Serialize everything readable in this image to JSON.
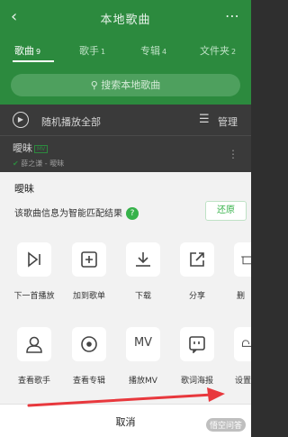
{
  "header": {
    "title": "本地歌曲",
    "back_icon": "back-arrow-icon",
    "more_icon": "more-dots-icon"
  },
  "tabs": [
    {
      "label": "歌曲",
      "count": "9",
      "active": true
    },
    {
      "label": "歌手",
      "count": "1",
      "active": false
    },
    {
      "label": "专辑",
      "count": "4",
      "active": false
    },
    {
      "label": "文件夹",
      "count": "2",
      "active": false
    }
  ],
  "search": {
    "placeholder": "搜索本地歌曲"
  },
  "list_header": {
    "play_all": "随机播放全部",
    "manage": "管理"
  },
  "song": {
    "name": "曖昧",
    "badge": "MV",
    "artist": "薛之谦 - 曖昧"
  },
  "sheet": {
    "song_name": "曖昧",
    "info_text": "该歌曲信息为智能匹配结果",
    "help_icon": "?",
    "restore_label": "还原",
    "row1": [
      {
        "label": "下一首播放",
        "icon": "play-next-icon"
      },
      {
        "label": "加到歌单",
        "icon": "add-to-playlist-icon"
      },
      {
        "label": "下载",
        "icon": "download-icon"
      },
      {
        "label": "分享",
        "icon": "share-icon"
      },
      {
        "label": "删",
        "icon": "delete-icon"
      }
    ],
    "row2": [
      {
        "label": "查看歌手",
        "icon": "artist-icon"
      },
      {
        "label": "查看专辑",
        "icon": "album-icon"
      },
      {
        "label": "播放MV",
        "icon": "mv-icon",
        "text": "MV"
      },
      {
        "label": "歌词海报",
        "icon": "lyrics-poster-icon"
      },
      {
        "label": "设置",
        "icon": "bell-icon"
      }
    ],
    "cancel_label": "取消"
  },
  "watermark": "悟空问答",
  "colors": {
    "accent": "#2c8a3e",
    "sheet_bg": "#f2f2f2",
    "arrow": "#e8383d"
  }
}
